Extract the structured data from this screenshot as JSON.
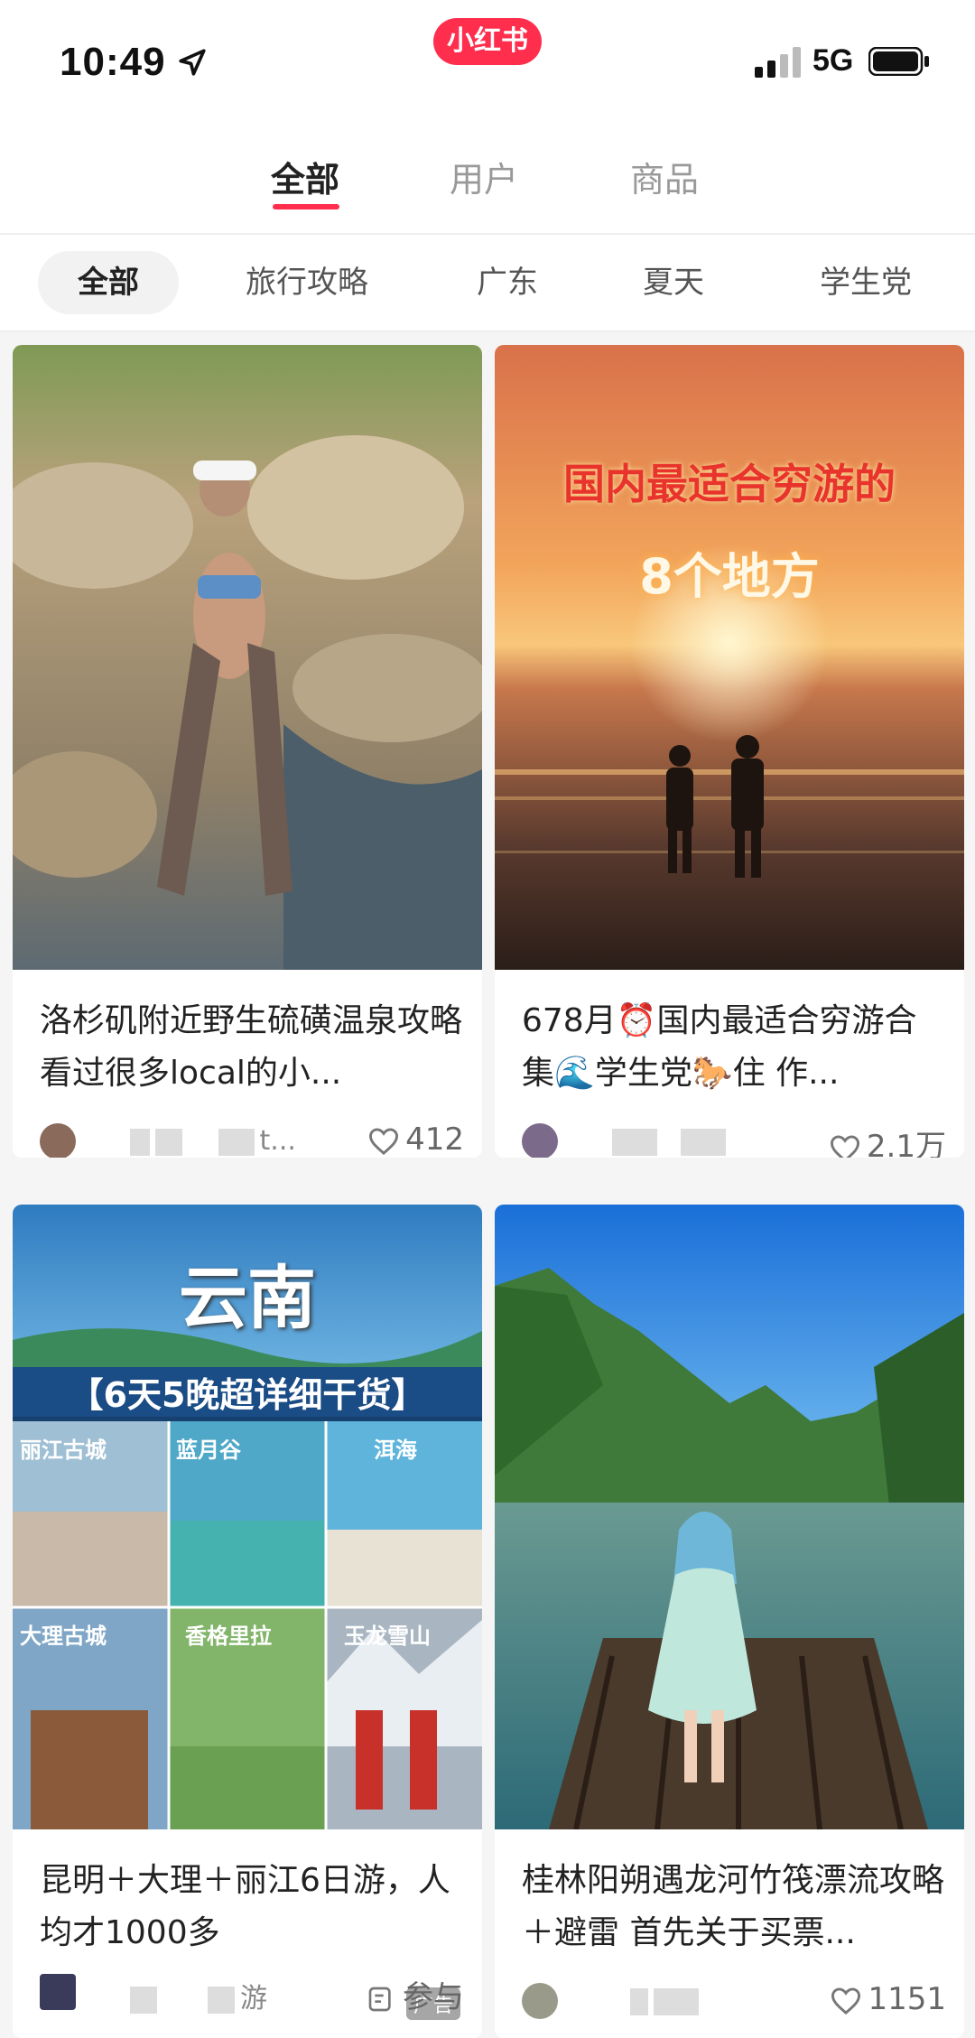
{
  "status_bar": {
    "time": "10:49",
    "app_badge": "小红书",
    "network": "5G"
  },
  "main_tabs": [
    {
      "label": "全部",
      "active": true
    },
    {
      "label": "用户",
      "active": false
    },
    {
      "label": "商品",
      "active": false
    }
  ],
  "filter_chips": [
    {
      "label": "全部",
      "active": true
    },
    {
      "label": "旅行攻略",
      "active": false
    },
    {
      "label": "广东",
      "active": false
    },
    {
      "label": "夏天",
      "active": false
    },
    {
      "label": "学生党",
      "active": false
    }
  ],
  "cards": [
    {
      "title": "洛杉矶附近野生硫磺温泉攻略 看过很多local的小...",
      "author": "t...",
      "likes": "412",
      "image": "hot-spring-photo"
    },
    {
      "title": "678月⏰国内最适合穷游合集🌊学生党🐎住 作...",
      "author": "",
      "likes": "2.1万",
      "image": "sunset-beach-photo",
      "overlay_line1": "国内最适合穷游的",
      "overlay_line2": "8个地方"
    },
    {
      "title": "昆明＋大理＋丽江6日游，人均才1000多",
      "author": "游",
      "action": "参与",
      "image": "yunnan-collage",
      "overlay_title": "云南",
      "overlay_subtitle": "【6天5晚超详细干货】",
      "collage_labels": [
        "丽江古城",
        "蓝月谷",
        "洱海",
        "大理古城",
        "香格里拉",
        "玉龙雪山"
      ],
      "ad_label": "广告"
    },
    {
      "title": "桂林阳朔遇龙河竹筏漂流攻略＋避雷 首先关于买票...",
      "author": "",
      "likes": "1151",
      "image": "river-raft-photo"
    }
  ],
  "colors": {
    "accent": "#ff2e4d",
    "text": "#222222",
    "muted": "#999999"
  }
}
